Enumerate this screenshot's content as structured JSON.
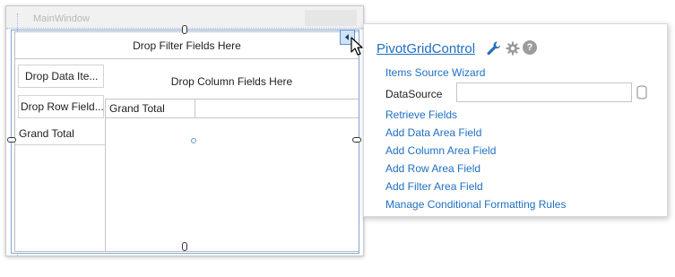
{
  "window": {
    "title": "MainWindow"
  },
  "pivot": {
    "filter_area": "Drop Filter Fields Here",
    "data_area": "Drop Data Ite...",
    "column_area": "Drop Column Fields Here",
    "row_area": "Drop Row Field...",
    "row_grand_total": "Grand Total",
    "column_grand_total": "Grand Total"
  },
  "panel": {
    "title": "PivotGridControl",
    "icons": [
      "wrench-icon",
      "gear-icon",
      "help-icon"
    ],
    "help_glyph": "?",
    "items_source_wizard": "Items Source Wizard",
    "datasource_label": "DataSource",
    "datasource_value": "",
    "links": [
      "Retrieve Fields",
      "Add Data Area Field",
      "Add Column Area Field",
      "Add Row Area Field",
      "Add Filter Area Field",
      "Manage Conditional Formatting Rules"
    ]
  },
  "colors": {
    "link": "#1f6fc2",
    "selection": "#7fa7dc"
  }
}
